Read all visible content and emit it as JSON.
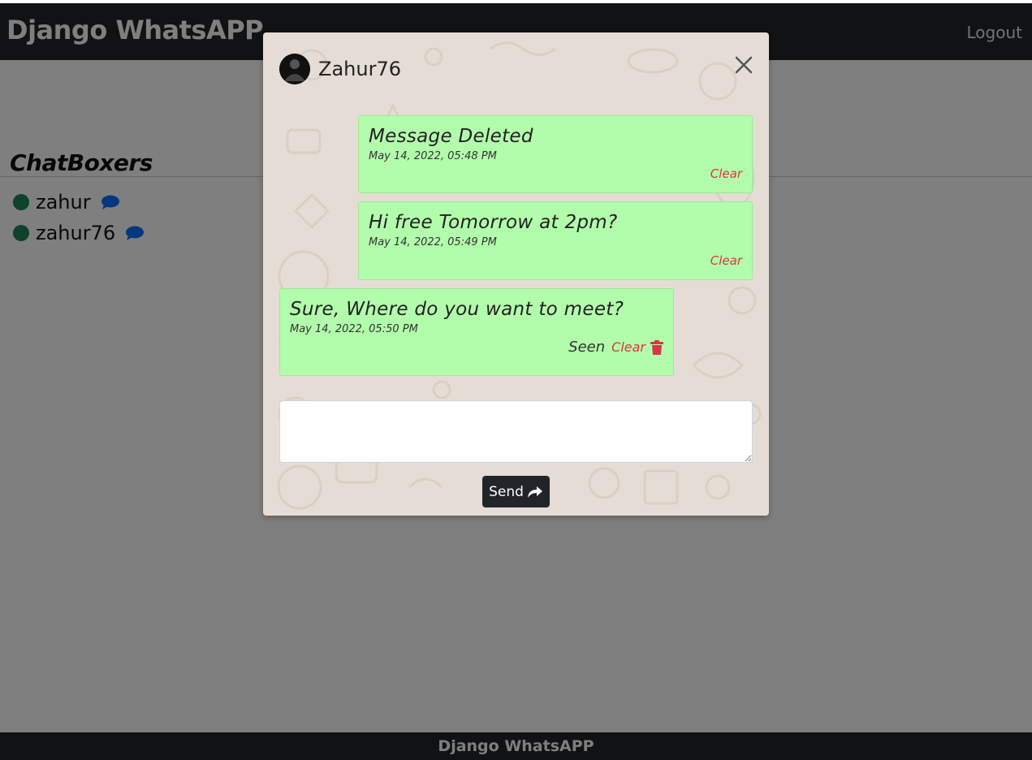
{
  "navbar": {
    "brand": "Django WhatsAPP",
    "logout_label": "Logout"
  },
  "sidebar": {
    "title": "ChatBoxers",
    "users": [
      {
        "name": "zahur",
        "status_color": "#198754",
        "icon": "chat-bubble-icon"
      },
      {
        "name": "zahur76",
        "status_color": "#198754",
        "icon": "chat-bubble-icon"
      }
    ]
  },
  "footer": {
    "text": "Django WhatsAPP"
  },
  "modal": {
    "contact_name": "Zahur76",
    "messages": [
      {
        "text": "Message Deleted",
        "timestamp": "May 14, 2022, 05:48 PM",
        "clear_label": "Clear"
      },
      {
        "text": "Hi free Tomorrow at 2pm?",
        "timestamp": "May 14, 2022, 05:49 PM",
        "clear_label": "Clear"
      },
      {
        "text": "Sure, Where do you want to meet?",
        "timestamp": "May 14, 2022, 05:50 PM",
        "seen_label": "Seen",
        "clear_label": "Clear"
      }
    ],
    "input": {
      "value": "",
      "placeholder": ""
    },
    "send_label": "Send"
  },
  "colors": {
    "navbar_bg": "#212529",
    "bubble_bg": "#b2fdab",
    "clear_text": "#dc3545",
    "online_dot": "#198754",
    "chat_icon": "#0d6efd"
  }
}
